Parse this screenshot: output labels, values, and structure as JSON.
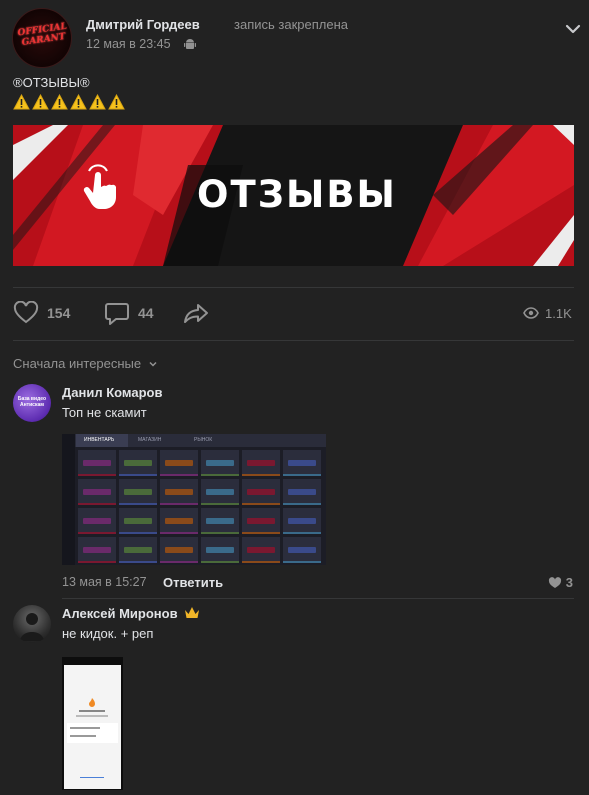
{
  "post": {
    "author": "Дмитрий Гордеев",
    "pinned_label": "запись закреплена",
    "time": "12 мая в 23:45",
    "avatar_text": "OFFICIAL GARANT",
    "title": "®ОТЗЫВЫ®",
    "banner_text": "ОТЗЫВЫ",
    "likes": "154",
    "comments": "44",
    "views": "1.1K"
  },
  "comments_section": {
    "sort_label": "Сначала интересные"
  },
  "comments": [
    {
      "author": "Данил Комаров",
      "text": "Топ не скамит",
      "avatar_text": "База видео Антискам",
      "time": "13 мая в 15:27",
      "reply": "Ответить",
      "likes": "3",
      "screenshot_tabs": [
        "ИНВЕНТАРЬ",
        "МАГАЗИН",
        "РЫНОК"
      ]
    },
    {
      "author": "Алексей Миронов",
      "text": "не кидок. + реп"
    }
  ],
  "colors": {
    "background": "#222222",
    "text": "#e1e3e6",
    "secondary": "#939393",
    "banner_red": "#c8101c"
  }
}
